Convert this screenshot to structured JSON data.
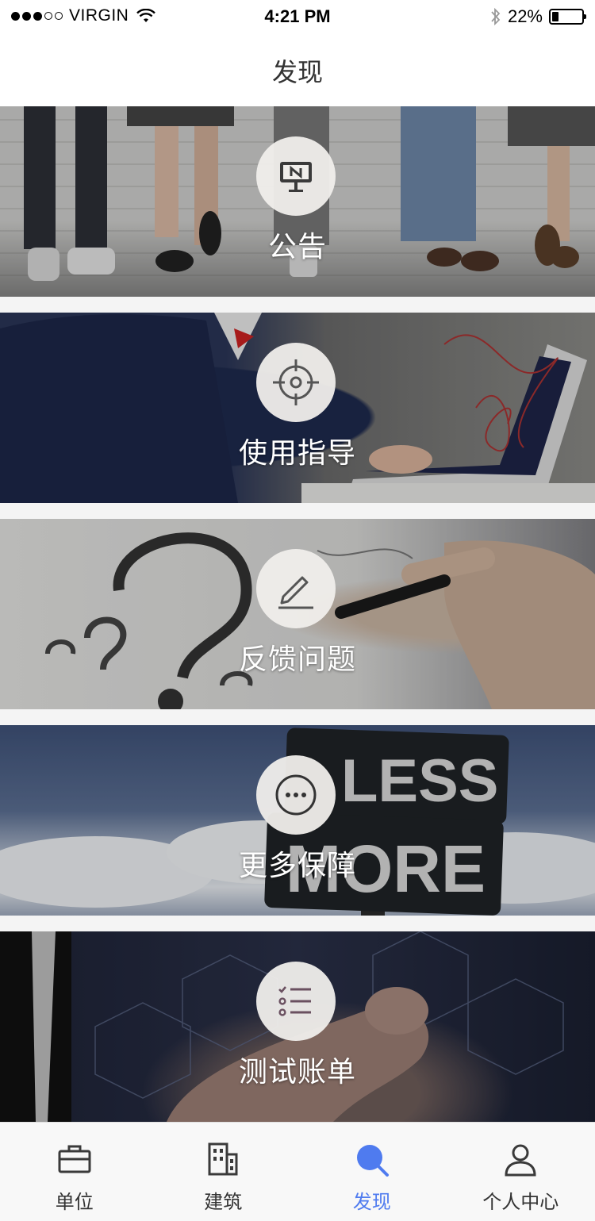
{
  "status_bar": {
    "carrier": "VIRGIN",
    "time": "4:21 PM",
    "battery": "22%",
    "battery_level": 0.22,
    "signal_bars_filled": 3,
    "signal_bars_total": 5
  },
  "nav": {
    "title": "发现"
  },
  "cards": [
    {
      "label": "公告",
      "icon": "billboard-icon"
    },
    {
      "label": "使用指导",
      "icon": "target-icon"
    },
    {
      "label": "反馈问题",
      "icon": "pencil-icon"
    },
    {
      "label": "更多保障",
      "icon": "more-icon"
    },
    {
      "label": "测试账单",
      "icon": "checklist-icon"
    }
  ],
  "tabs": [
    {
      "label": "单位",
      "icon": "briefcase-icon",
      "active": false
    },
    {
      "label": "建筑",
      "icon": "building-icon",
      "active": false
    },
    {
      "label": "发现",
      "icon": "search-icon",
      "active": true
    },
    {
      "label": "个人中心",
      "icon": "user-icon",
      "active": false
    }
  ],
  "colors": {
    "accent": "#4f7bef",
    "tab_text": "#333333",
    "icon_dark": "#3a3a3a"
  }
}
